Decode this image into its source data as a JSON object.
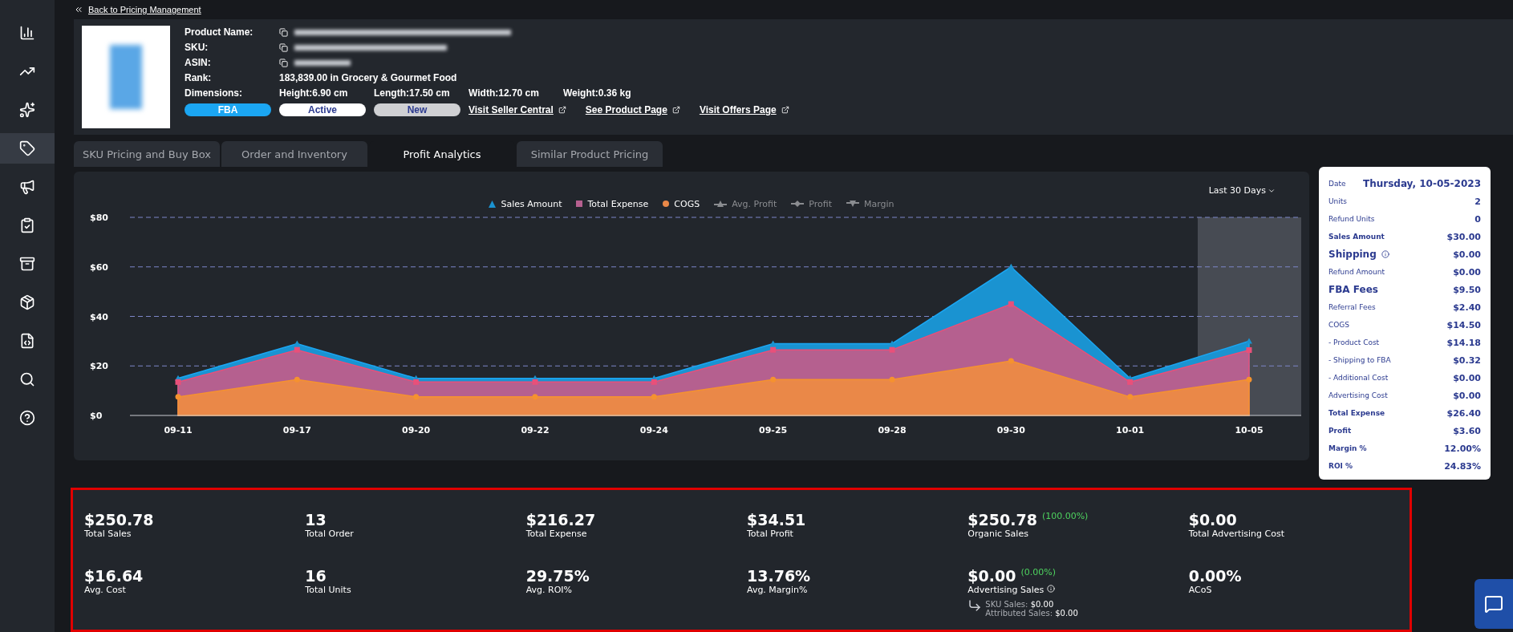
{
  "sidebar": {
    "items": [
      {
        "selected": false
      },
      {
        "selected": false
      },
      {
        "selected": false
      },
      {
        "selected": true
      },
      {
        "selected": false
      },
      {
        "selected": false
      },
      {
        "selected": false
      },
      {
        "selected": false
      },
      {
        "selected": false
      },
      {
        "selected": false
      },
      {
        "selected": false
      }
    ]
  },
  "back_link": "Back to Pricing Management",
  "product": {
    "fields": [
      {
        "label": "Product Name:",
        "kind": "redacted"
      },
      {
        "label": "SKU:",
        "kind": "redacted"
      },
      {
        "label": "ASIN:",
        "kind": "redacted"
      },
      {
        "label": "Rank:",
        "kind": "text",
        "value": "183,839.00 in Grocery & Gourmet Food"
      }
    ],
    "dimensions": {
      "label": "Dimensions:",
      "values": [
        "Height:6.90 cm",
        "Length:17.50 cm",
        "Width:12.70 cm",
        "Weight:0.36 kg"
      ]
    },
    "badges": [
      {
        "label": "FBA",
        "color": "#1ba6f2"
      },
      {
        "label": "Active",
        "color": "#ffffff"
      },
      {
        "label": "New",
        "color": "#cfd0d3"
      }
    ],
    "links": [
      "Visit Seller Central",
      "See Product Page",
      "Visit Offers Page"
    ]
  },
  "tabs": [
    {
      "label": "SKU Pricing and Buy Box",
      "selected": false
    },
    {
      "label": "Order and Inventory",
      "selected": false
    },
    {
      "label": "Profit Analytics",
      "selected": true
    },
    {
      "label": "Similar Product Pricing",
      "selected": false
    }
  ],
  "period": "Last 30 Days",
  "hidden_legend": [
    "Avg. Profit",
    "Profit",
    "Margin"
  ],
  "chart_data": {
    "type": "area",
    "categories": [
      "09-11",
      "09-17",
      "09-20",
      "09-22",
      "09-24",
      "09-25",
      "09-28",
      "09-30",
      "10-01",
      "10-05"
    ],
    "series": [
      {
        "name": "Sales Amount",
        "color": "#1a93d1",
        "values": [
          15,
          29,
          15,
          15,
          15,
          29,
          29,
          60,
          15,
          30
        ]
      },
      {
        "name": "Total Expense",
        "color": "#b5608f",
        "values": [
          13.5,
          26.5,
          13.5,
          13.5,
          13.5,
          26.5,
          26.5,
          45,
          13.5,
          26.4
        ]
      },
      {
        "name": "COGS",
        "color": "#ea8848",
        "values": [
          7.5,
          14.5,
          7.5,
          7.5,
          7.5,
          14.5,
          14.5,
          22,
          7.5,
          14.5
        ]
      }
    ],
    "ylim": [
      0,
      80
    ],
    "yticks": [
      {
        "value": 0,
        "label": "$0"
      },
      {
        "value": 20,
        "label": "$20"
      },
      {
        "value": 40,
        "label": "$40"
      },
      {
        "value": 60,
        "label": "$60"
      },
      {
        "value": 80,
        "label": "$80"
      }
    ],
    "grid": true
  },
  "tooltip": {
    "rows": [
      {
        "label": "Date",
        "value": "Thursday, 10-05-2023",
        "kind": "date"
      },
      {
        "label": "Units",
        "value": "2",
        "kind": "normal"
      },
      {
        "label": "Refund Units",
        "value": "0",
        "kind": "normal"
      },
      {
        "label": "Sales Amount",
        "value": "$30.00",
        "kind": "bold"
      },
      {
        "label": "Shipping",
        "value": "$0.00",
        "kind": "heading",
        "info": true
      },
      {
        "label": "Refund Amount",
        "value": "$0.00",
        "kind": "normal"
      },
      {
        "label": "FBA Fees",
        "value": "$9.50",
        "kind": "heading"
      },
      {
        "label": "Referral Fees",
        "value": "$2.40",
        "kind": "normal"
      },
      {
        "label": "COGS",
        "value": "$14.50",
        "kind": "normal"
      },
      {
        "label": "- Product Cost",
        "value": "$14.18",
        "kind": "normal"
      },
      {
        "label": "- Shipping to FBA",
        "value": "$0.32",
        "kind": "normal"
      },
      {
        "label": "- Additional Cost",
        "value": "$0.00",
        "kind": "normal"
      },
      {
        "label": "Advertising Cost",
        "value": "$0.00",
        "kind": "normal"
      },
      {
        "label": "Total Expense",
        "value": "$26.40",
        "kind": "bold"
      },
      {
        "label": "Profit",
        "value": "$3.60",
        "kind": "bold"
      },
      {
        "label": "Margin %",
        "value": "12.00%",
        "kind": "bold"
      },
      {
        "label": "ROI %",
        "value": "24.83%",
        "kind": "bold"
      }
    ]
  },
  "stats": [
    {
      "value": "$250.78",
      "label": "Total Sales"
    },
    {
      "value": "13",
      "label": "Total Order"
    },
    {
      "value": "$216.27",
      "label": "Total Expense"
    },
    {
      "value": "$34.51",
      "label": "Total Profit"
    },
    {
      "value": "$250.78",
      "label": "Organic Sales",
      "share": "(100.00%)"
    },
    {
      "value": "$0.00",
      "label": "Total Advertising Cost"
    },
    {
      "value": "$16.64",
      "label": "Avg. Cost"
    },
    {
      "value": "16",
      "label": "Total Units"
    },
    {
      "value": "29.75%",
      "label": "Avg. ROI%"
    },
    {
      "value": "13.76%",
      "label": "Avg. Margin%"
    },
    {
      "value": "$0.00",
      "label": "Advertising Sales",
      "share": "(0.00%)",
      "info": true,
      "breakdown": [
        {
          "label": "SKU Sales:",
          "value": "$0.00"
        },
        {
          "label": "Attributed Sales:",
          "value": "$0.00"
        }
      ]
    },
    {
      "value": "0.00%",
      "label": "ACoS"
    }
  ]
}
